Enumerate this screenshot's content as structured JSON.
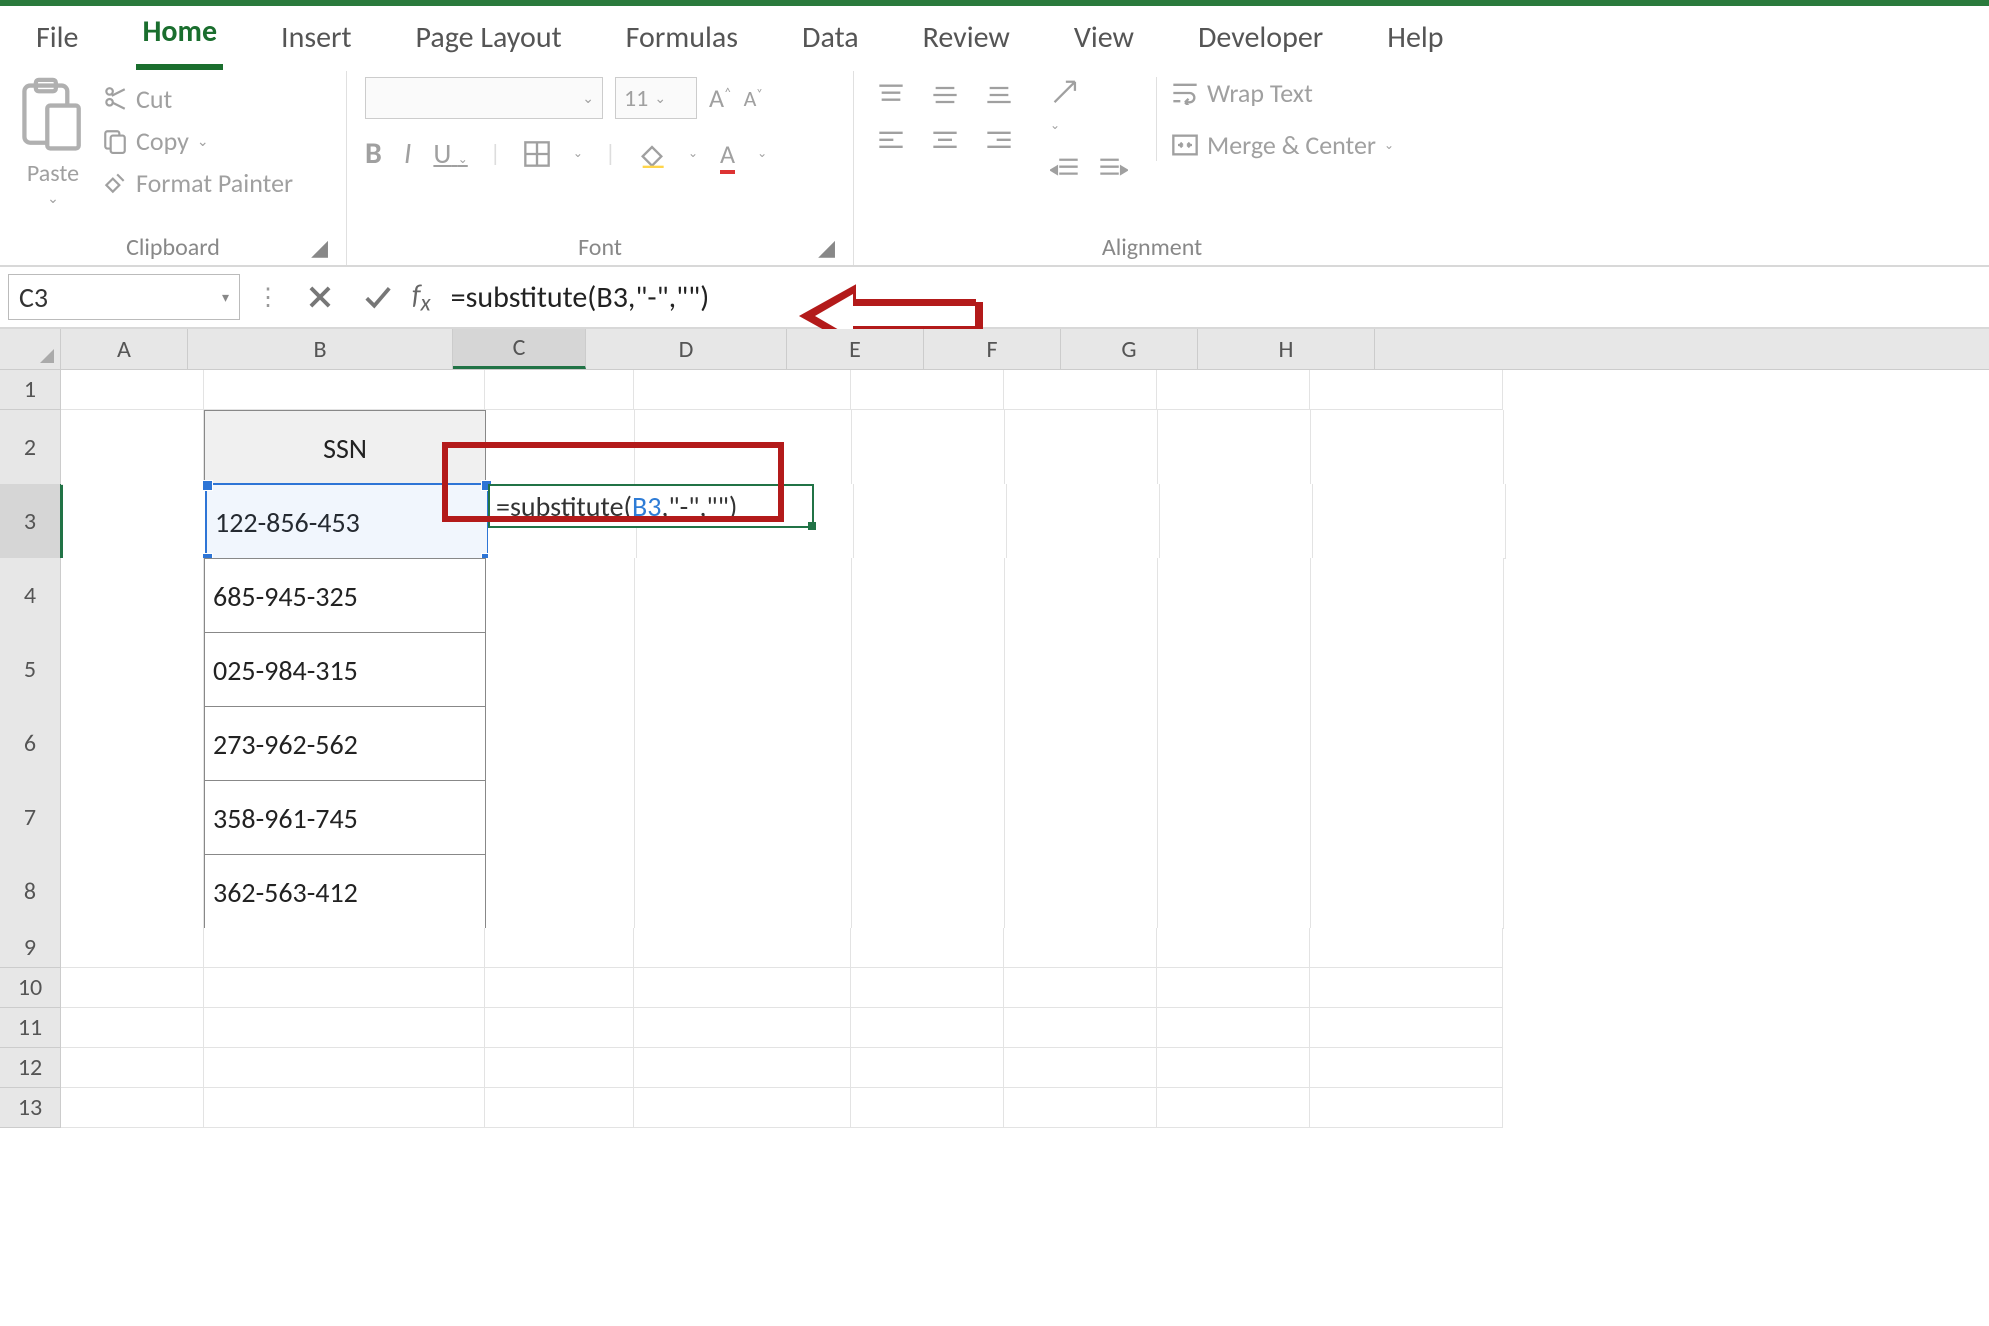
{
  "tabs": [
    "File",
    "Home",
    "Insert",
    "Page Layout",
    "Formulas",
    "Data",
    "Review",
    "View",
    "Developer",
    "Help"
  ],
  "activeTab": "Home",
  "ribbon": {
    "clipboard": {
      "paste": "Paste",
      "cut": "Cut",
      "copy": "Copy",
      "formatPainter": "Format Painter",
      "group": "Clipboard"
    },
    "font": {
      "size": "11",
      "bold": "B",
      "italic": "I",
      "underline": "U",
      "group": "Font"
    },
    "alignment": {
      "wrap": "Wrap Text",
      "merge": "Merge & Center",
      "group": "Alignment"
    }
  },
  "formulaBar": {
    "nameBox": "C3",
    "formula": "=substitute(B3,\"-\",\"\")"
  },
  "columns": [
    "A",
    "B",
    "C",
    "D",
    "E",
    "F",
    "G",
    "H"
  ],
  "colWidths": {
    "A": 126,
    "B": 264,
    "C": 132,
    "D": 200,
    "E": 136,
    "F": 136,
    "G": 136,
    "H": 176,
    "rest": 60
  },
  "rowLabels": [
    "1",
    "2",
    "3",
    "4",
    "5",
    "6",
    "7",
    "8",
    "9",
    "10",
    "11",
    "12",
    "13"
  ],
  "sheet": {
    "headerB2": "SSN",
    "dataB": [
      "122-856-453",
      "685-945-325",
      "025-984-315",
      "273-962-562",
      "358-961-745",
      "362-563-412"
    ],
    "c3FormulaParts": {
      "prefix": "=substitute(",
      "ref": "B3",
      "suffix": ",\"-\",\"\")"
    }
  }
}
